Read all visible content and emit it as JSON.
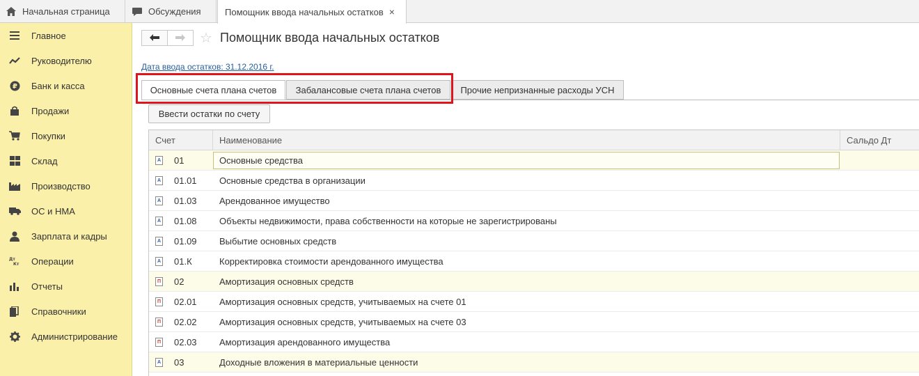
{
  "tabs": [
    {
      "label": "Начальная страница",
      "icon": "home-icon"
    },
    {
      "label": "Обсуждения",
      "icon": "chat-icon"
    },
    {
      "label": "Помощник ввода начальных остатков",
      "icon": "",
      "close": "×"
    }
  ],
  "sidebar": {
    "items": [
      {
        "label": "Главное",
        "icon": "menu-icon"
      },
      {
        "label": "Руководителю",
        "icon": "chart-line-icon"
      },
      {
        "label": "Банк и касса",
        "icon": "ruble-icon"
      },
      {
        "label": "Продажи",
        "icon": "bag-icon"
      },
      {
        "label": "Покупки",
        "icon": "cart-icon"
      },
      {
        "label": "Склад",
        "icon": "warehouse-icon"
      },
      {
        "label": "Производство",
        "icon": "factory-icon"
      },
      {
        "label": "ОС и НМА",
        "icon": "truck-icon"
      },
      {
        "label": "Зарплата и кадры",
        "icon": "person-icon"
      },
      {
        "label": "Операции",
        "icon": "dt-kt-icon"
      },
      {
        "label": "Отчеты",
        "icon": "bar-chart-icon"
      },
      {
        "label": "Справочники",
        "icon": "book-icon"
      },
      {
        "label": "Администрирование",
        "icon": "gear-icon"
      }
    ]
  },
  "main": {
    "title": "Помощник ввода начальных остатков",
    "date_link": "Дата ввода остатков: 31.12.2016 г.",
    "tabs": [
      "Основные счета плана счетов",
      "Забалансовые счета плана счетов",
      "Прочие непризнанные расходы УСН"
    ],
    "enter_button": "Ввести остатки по счету",
    "grid": {
      "columns": [
        "Счет",
        "Наименование",
        "Сальдо Дт"
      ],
      "rows": [
        {
          "code": "01",
          "name": "Основные средства",
          "group": true,
          "selected": true
        },
        {
          "code": "01.01",
          "name": "Основные средства в организации",
          "group": false
        },
        {
          "code": "01.03",
          "name": "Арендованное имущество",
          "group": false
        },
        {
          "code": "01.08",
          "name": "Объекты недвижимости, права собственности на которые не зарегистрированы",
          "group": false
        },
        {
          "code": "01.09",
          "name": "Выбытие основных средств",
          "group": false
        },
        {
          "code": "01.К",
          "name": "Корректировка стоимости арендованного имущества",
          "group": false
        },
        {
          "code": "02",
          "name": "Амортизация основных средств",
          "group": true
        },
        {
          "code": "02.01",
          "name": "Амортизация основных средств, учитываемых на счете 01",
          "group": false
        },
        {
          "code": "02.02",
          "name": "Амортизация основных средств, учитываемых на счете 03",
          "group": false
        },
        {
          "code": "02.03",
          "name": "Амортизация арендованного имущества",
          "group": false
        },
        {
          "code": "03",
          "name": "Доходные вложения в материальные ценности",
          "group": true
        }
      ]
    }
  }
}
